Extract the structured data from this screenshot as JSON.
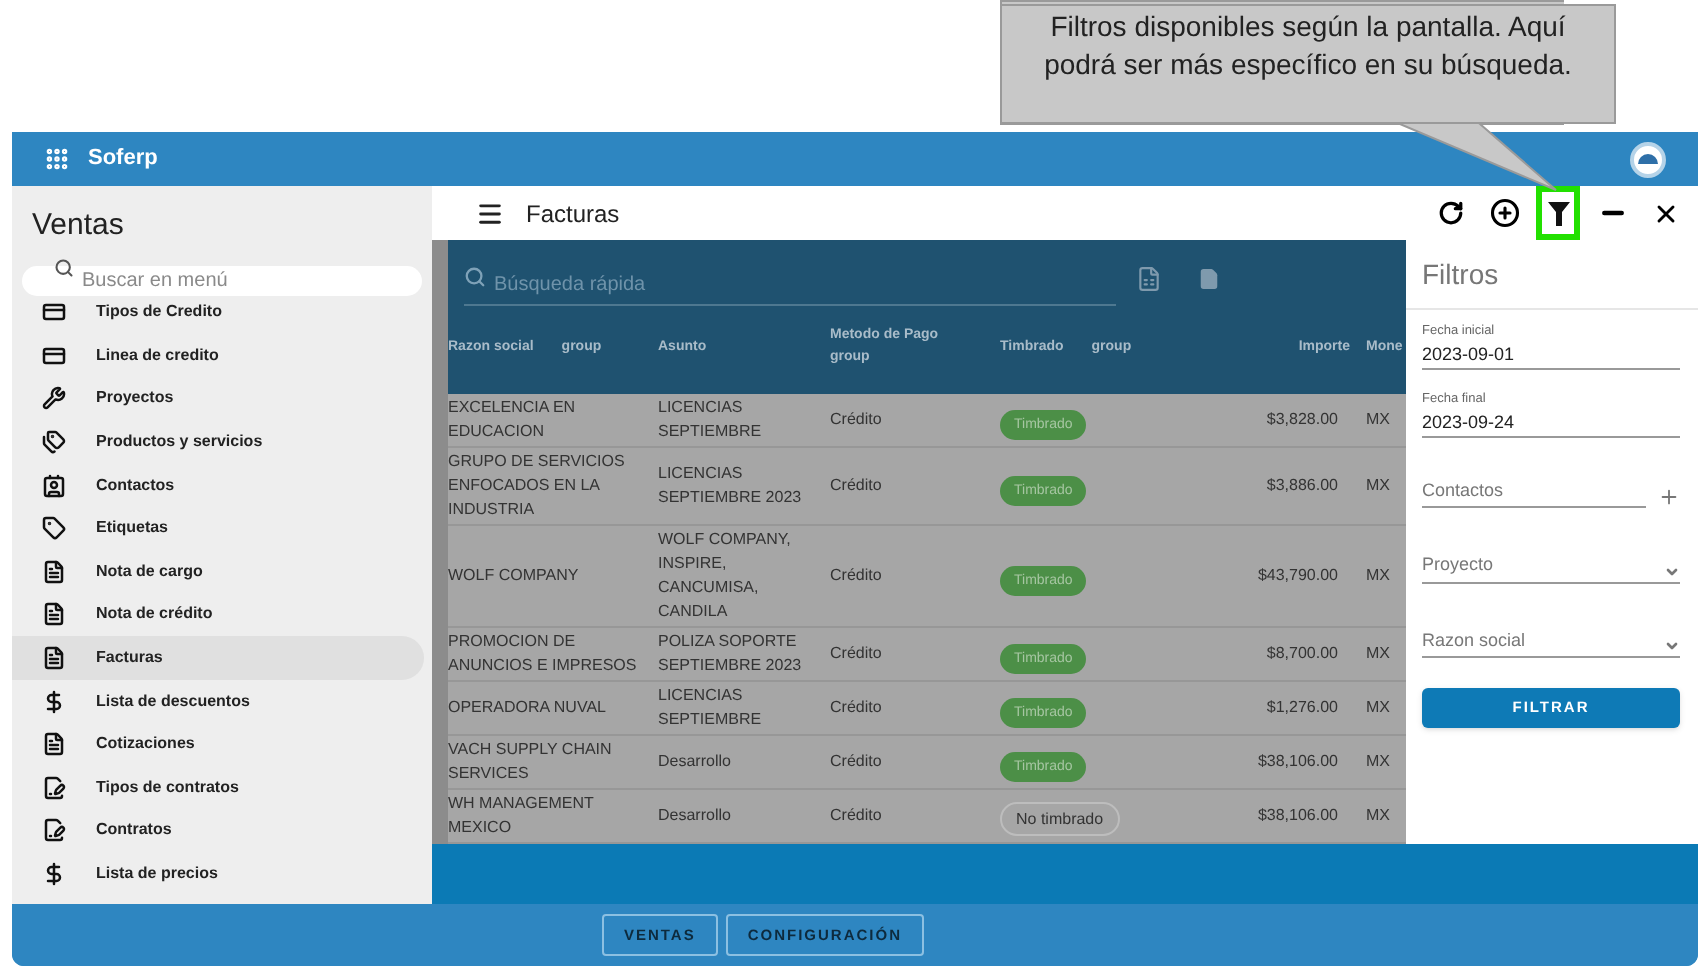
{
  "callout": {
    "text": "Filtros disponibles según la pantalla. Aquí podrá ser más específico en su búsqueda."
  },
  "app": {
    "title": "Soferp"
  },
  "sidebar": {
    "title": "Ventas",
    "search": {
      "placeholder": "Buscar en menú"
    },
    "items": [
      {
        "label": "Tipos de Credito",
        "kind": "card",
        "selected": false
      },
      {
        "label": "Linea de credito",
        "kind": "card",
        "selected": false
      },
      {
        "label": "Proyectos",
        "kind": "tools",
        "selected": false
      },
      {
        "label": "Productos y servicios",
        "kind": "tags",
        "selected": false
      },
      {
        "label": "Contactos",
        "kind": "contact",
        "selected": false
      },
      {
        "label": "Etiquetas",
        "kind": "tag",
        "selected": false
      },
      {
        "label": "Nota de cargo",
        "kind": "doc",
        "selected": false
      },
      {
        "label": "Nota de crédito",
        "kind": "doc",
        "selected": false
      },
      {
        "label": "Facturas",
        "kind": "doc",
        "selected": true
      },
      {
        "label": "Lista de descuentos",
        "kind": "money",
        "selected": false
      },
      {
        "label": "Cotizaciones",
        "kind": "doc",
        "selected": false
      },
      {
        "label": "Tipos de contratos",
        "kind": "contract",
        "selected": false
      },
      {
        "label": "Contratos",
        "kind": "contract",
        "selected": false
      },
      {
        "label": "Lista de precios",
        "kind": "money",
        "selected": false
      }
    ]
  },
  "page": {
    "title": "Facturas",
    "toolbar": [
      {
        "kind": "refresh",
        "highlighted": false
      },
      {
        "kind": "add",
        "highlighted": false
      },
      {
        "kind": "filter",
        "highlighted": true
      },
      {
        "kind": "minimize",
        "highlighted": false
      },
      {
        "kind": "close",
        "highlighted": false
      }
    ]
  },
  "table": {
    "search": {
      "placeholder": "Búsqueda rápida"
    },
    "columns": [
      {
        "label": "Razon social",
        "tag": "group"
      },
      {
        "label": "Asunto"
      },
      {
        "label": "Metodo de Pago",
        "tag": "group"
      },
      {
        "label": "Timbrado",
        "tag": "group"
      },
      {
        "label": "Importe"
      },
      {
        "label": "Mone"
      }
    ],
    "rows": [
      {
        "cells": [
          "EXCELENCIA EN EDUCACION",
          "LICENCIAS SEPTIEMBRE",
          "Crédito",
          "Timbrado",
          "$3,828.00",
          "MX"
        ],
        "stamped": true
      },
      {
        "cells": [
          "GRUPO DE SERVICIOS ENFOCADOS EN LA INDUSTRIA",
          "LICENCIAS SEPTIEMBRE 2023",
          "Crédito",
          "Timbrado",
          "$3,886.00",
          "MX"
        ],
        "stamped": true
      },
      {
        "cells": [
          "WOLF COMPANY",
          "WOLF COMPANY, INSPIRE, CANCUMISA, CANDILA",
          "Crédito",
          "Timbrado",
          "$43,790.00",
          "MX"
        ],
        "stamped": true
      },
      {
        "cells": [
          "PROMOCION DE ANUNCIOS E IMPRESOS",
          "POLIZA SOPORTE SEPTIEMBRE 2023",
          "Crédito",
          "Timbrado",
          "$8,700.00",
          "MX"
        ],
        "stamped": true
      },
      {
        "cells": [
          "OPERADORA NUVAL",
          "LICENCIAS SEPTIEMBRE",
          "Crédito",
          "Timbrado",
          "$1,276.00",
          "MX"
        ],
        "stamped": true
      },
      {
        "cells": [
          "VACH SUPPLY CHAIN SERVICES",
          "Desarrollo",
          "Crédito",
          "Timbrado",
          "$38,106.00",
          "MX"
        ],
        "stamped": true
      },
      {
        "cells": [
          "WH MANAGEMENT MEXICO",
          "Desarrollo",
          "Crédito",
          "No timbrado",
          "$38,106.00",
          "MX"
        ],
        "stamped": false
      }
    ]
  },
  "filters": {
    "title": "Filtros",
    "fields": [
      {
        "kind": "date",
        "label": "Fecha inicial",
        "value": "2023-09-01"
      },
      {
        "kind": "date",
        "label": "Fecha final",
        "value": "2023-09-24"
      },
      {
        "kind": "add",
        "placeholder": "Contactos"
      },
      {
        "kind": "select",
        "placeholder": "Proyecto"
      },
      {
        "kind": "select",
        "placeholder": "Razon social"
      }
    ],
    "button": "FILTRAR"
  },
  "bottom_tabs": [
    "VENTAS",
    "CONFIGURACIÓN"
  ]
}
